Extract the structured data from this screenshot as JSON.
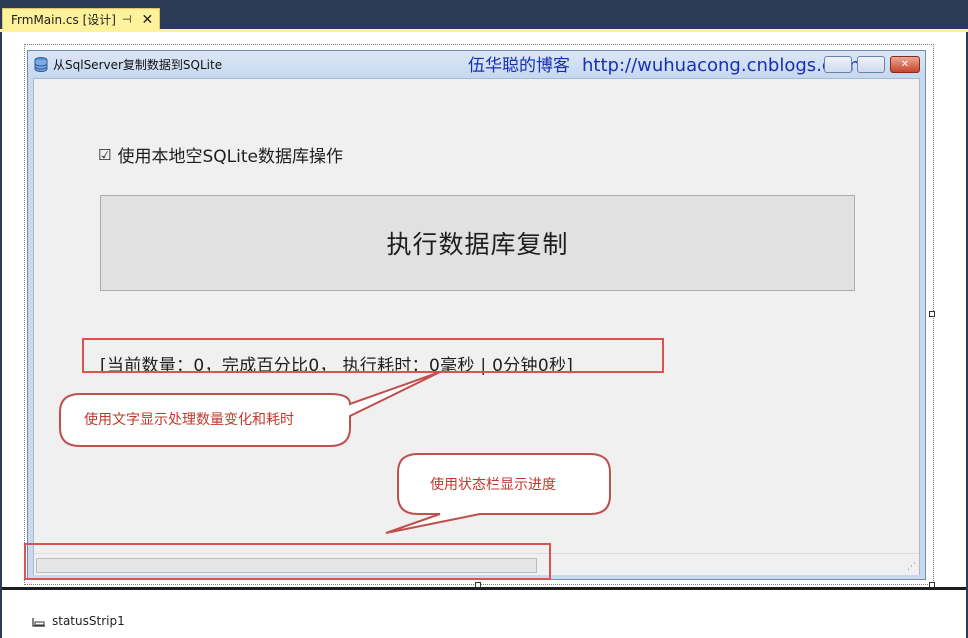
{
  "tab": {
    "title": "FrmMain.cs [设计]",
    "pin_glyph": "⊣",
    "close_glyph": "✕"
  },
  "window": {
    "title": "从SqlServer复制数据到SQLite",
    "icon": "database-icon",
    "blog_name": "伍华聪的博客",
    "blog_url": "http://wuhuacong.cnblogs.com",
    "close_glyph": "✕"
  },
  "form": {
    "checkbox_glyph": "☑",
    "checkbox_label": "使用本地空SQLite数据库操作",
    "checkbox_checked": true,
    "run_button_label": "执行数据库复制",
    "status_text": "[当前数量：0，完成百分比0， 执行耗时：0毫秒 | 0分钟0秒]"
  },
  "statusbar": {
    "progress_value": 0,
    "grip_icon": "resize-grip-icon"
  },
  "callouts": {
    "text_callout": "使用文字显示处理数量变化和耗时",
    "progress_callout": "使用状态栏显示进度"
  },
  "tray": {
    "component_name": "statusStrip1",
    "component_icon": "status-strip-icon"
  },
  "colors": {
    "tab_active": "#fff29d",
    "ide_background": "#2b3a55",
    "annotation_red": "#d9534f",
    "blog_text": "#1a2fb0"
  }
}
